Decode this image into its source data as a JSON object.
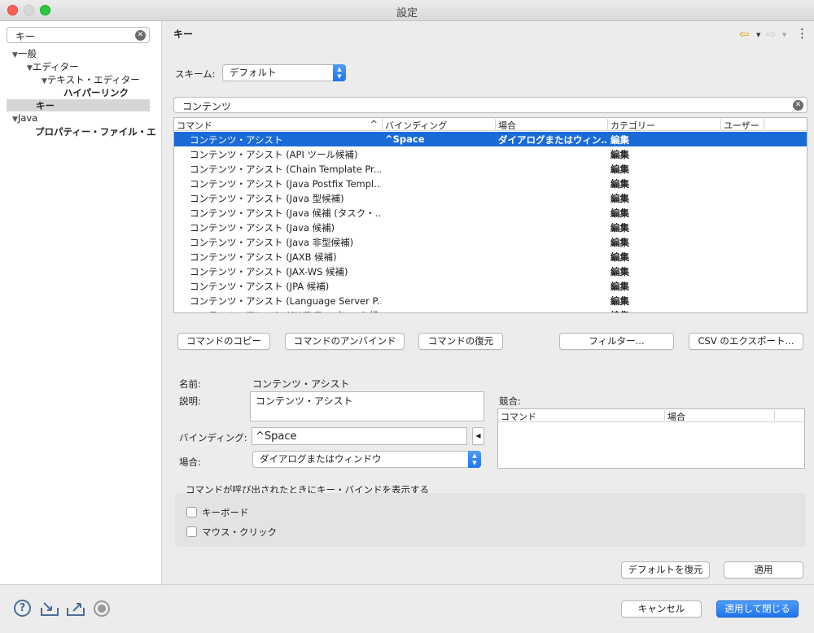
{
  "window": {
    "title": "設定"
  },
  "sidebar": {
    "search_value": "キー",
    "tree": [
      {
        "label": "一般",
        "twisty": "▼"
      },
      {
        "label": "エディター",
        "twisty": "▼"
      },
      {
        "label": "テキスト・エディター",
        "twisty": "▼"
      },
      {
        "label": "ハイパーリンク",
        "twisty": ""
      },
      {
        "label": "キー",
        "twisty": ""
      },
      {
        "label": "Java",
        "twisty": "▼"
      },
      {
        "label": "プロパティー・ファイル・エ",
        "twisty": ""
      }
    ]
  },
  "page": {
    "title": "キー",
    "nav_back": "⇦",
    "nav_forward": "⇨",
    "menu_dots": "⋮"
  },
  "scheme": {
    "label": "スキーム:",
    "value": "デフォルト"
  },
  "filter": {
    "value": "コンテンツ"
  },
  "table": {
    "columns": [
      "コマンド",
      "バインディング",
      "場合",
      "カテゴリー",
      "ユーザー"
    ],
    "sort_indicator": "^",
    "rows": [
      {
        "command": "コンテンツ・アシスト",
        "binding": "^Space",
        "when": "ダイアログまたはウィン…",
        "category": "編集",
        "user": ""
      },
      {
        "command": "コンテンツ・アシスト (API ツール候補)",
        "binding": "",
        "when": "",
        "category": "編集",
        "user": ""
      },
      {
        "command": "コンテンツ・アシスト (Chain Template Pr...",
        "binding": "",
        "when": "",
        "category": "編集",
        "user": ""
      },
      {
        "command": "コンテンツ・アシスト (Java Postfix Templ...",
        "binding": "",
        "when": "",
        "category": "編集",
        "user": ""
      },
      {
        "command": "コンテンツ・アシスト (Java 型候補)",
        "binding": "",
        "when": "",
        "category": "編集",
        "user": ""
      },
      {
        "command": "コンテンツ・アシスト (Java 候補 (タスク・…",
        "binding": "",
        "when": "",
        "category": "編集",
        "user": ""
      },
      {
        "command": "コンテンツ・アシスト (Java 候補)",
        "binding": "",
        "when": "",
        "category": "編集",
        "user": ""
      },
      {
        "command": "コンテンツ・アシスト (Java 非型候補)",
        "binding": "",
        "when": "",
        "category": "編集",
        "user": ""
      },
      {
        "command": "コンテンツ・アシスト (JAXB 候補)",
        "binding": "",
        "when": "",
        "category": "編集",
        "user": ""
      },
      {
        "command": "コンテンツ・アシスト (JAX-WS 候補)",
        "binding": "",
        "when": "",
        "category": "編集",
        "user": ""
      },
      {
        "command": "コンテンツ・アシスト (JPA 候補)",
        "binding": "",
        "when": "",
        "category": "編集",
        "user": ""
      },
      {
        "command": "コンテンツ・アシスト (Language Server P...",
        "binding": "",
        "when": "",
        "category": "編集",
        "user": ""
      },
      {
        "command": "コンテンツ・アシスト (SWT テンプレート候…",
        "binding": "",
        "when": "",
        "category": "編集",
        "user": ""
      }
    ]
  },
  "actions": {
    "copy": "コマンドのコピー",
    "unbind": "コマンドのアンバインド",
    "restore": "コマンドの復元",
    "filter": "フィルター...",
    "export": "CSV のエクスポート..."
  },
  "details": {
    "name_label": "名前:",
    "name_value": "コンテンツ・アシスト",
    "desc_label": "説明:",
    "desc_value": "コンテンツ・アシスト",
    "binding_label": "バインディング:",
    "binding_value": "^Space",
    "binding_menu_icon": "◀",
    "when_label": "場合:",
    "when_value": "ダイアログまたはウィンドウ",
    "conflicts_label": "競合:",
    "conflict_columns": [
      "コマンド",
      "場合"
    ]
  },
  "show_binding": {
    "title": "コマンドが呼び出されたときにキー・バインドを表示する",
    "keyboard": "キーボード",
    "mouse": "マウス・クリック",
    "keyboard_checked": false,
    "mouse_checked": false
  },
  "footer": {
    "restore_defaults": "デフォルトを復元",
    "apply": "適用",
    "cancel": "キャンセル",
    "apply_close": "適用して閉じる"
  },
  "colors": {
    "selection": "#1a6ad7",
    "primary": "#1e74ee",
    "close": "#fd5f57",
    "minimize": "#d9d9d9",
    "maximize": "#28c840"
  }
}
